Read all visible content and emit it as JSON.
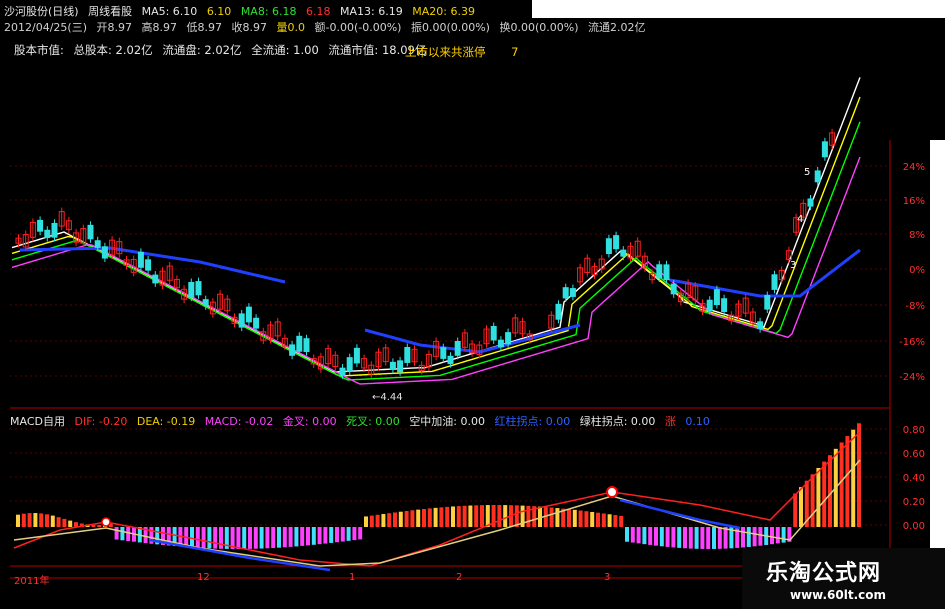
{
  "header": {
    "stock": "沙河股份(日线)",
    "view": "周线看股",
    "ma5": "MA5: 6.10",
    "ma5b": "6.10",
    "ma8": "MA8: 6.18",
    "ma8b": "6.18",
    "ma13": "MA13: 6.19",
    "ma20": "MA20: 6.39"
  },
  "quote": {
    "date": "2012/04/25(三)",
    "open": "开8.97",
    "high": "高8.97",
    "low": "低8.97",
    "close": "收8.97",
    "vol": "量0.0",
    "chg": "额-0.00(-0.00%)",
    "amp": "振0.00(0.00%)",
    "turn": "换0.00(0.00%)",
    "float": "流通2.02亿"
  },
  "capital": {
    "label": "股本市值:",
    "total_shares": "总股本: 2.02亿",
    "float_shares": "流通盘: 2.02亿",
    "full_float": "全流通: 1.00",
    "float_value": "流通市值: 18.09亿"
  },
  "limit_up": {
    "label": "上市以来共涨停",
    "count": "7"
  },
  "annotations": {
    "low_price": "←4.44",
    "wave": [
      "5",
      "4",
      "3"
    ]
  },
  "pct_axis": [
    "24%",
    "16%",
    "8%",
    "0%",
    "-8%",
    "-16%",
    "-24%"
  ],
  "macd_axis": [
    "0.80",
    "0.60",
    "0.40",
    "0.20",
    "0.00"
  ],
  "macd_header": {
    "name": "MACD自用",
    "dif": "DIF: -0.20",
    "dea": "DEA: -0.19",
    "macd": "MACD: -0.02",
    "golden": "金叉: 0.00",
    "dead": "死叉: 0.00",
    "air": "空中加油: 0.00",
    "red_pivot": "红柱拐点: 0.00",
    "green_pivot": "绿柱拐点: 0.00",
    "up": "涨",
    "up_val": "0.10"
  },
  "x_axis": [
    {
      "label": "2011年"
    },
    {
      "label": "12"
    },
    {
      "label": "1"
    },
    {
      "label": "2"
    },
    {
      "label": "3"
    }
  ],
  "logo": {
    "cn": "乐淘公式网",
    "url": "www.60lt.com"
  },
  "colors": {
    "up": "#ff2020",
    "down": "#30e0e0",
    "ma5": "#ffffff",
    "ma8": "#ffff00",
    "ma13": "#00ff00",
    "ma20": "#ff40ff",
    "blue": "#2040ff"
  }
}
